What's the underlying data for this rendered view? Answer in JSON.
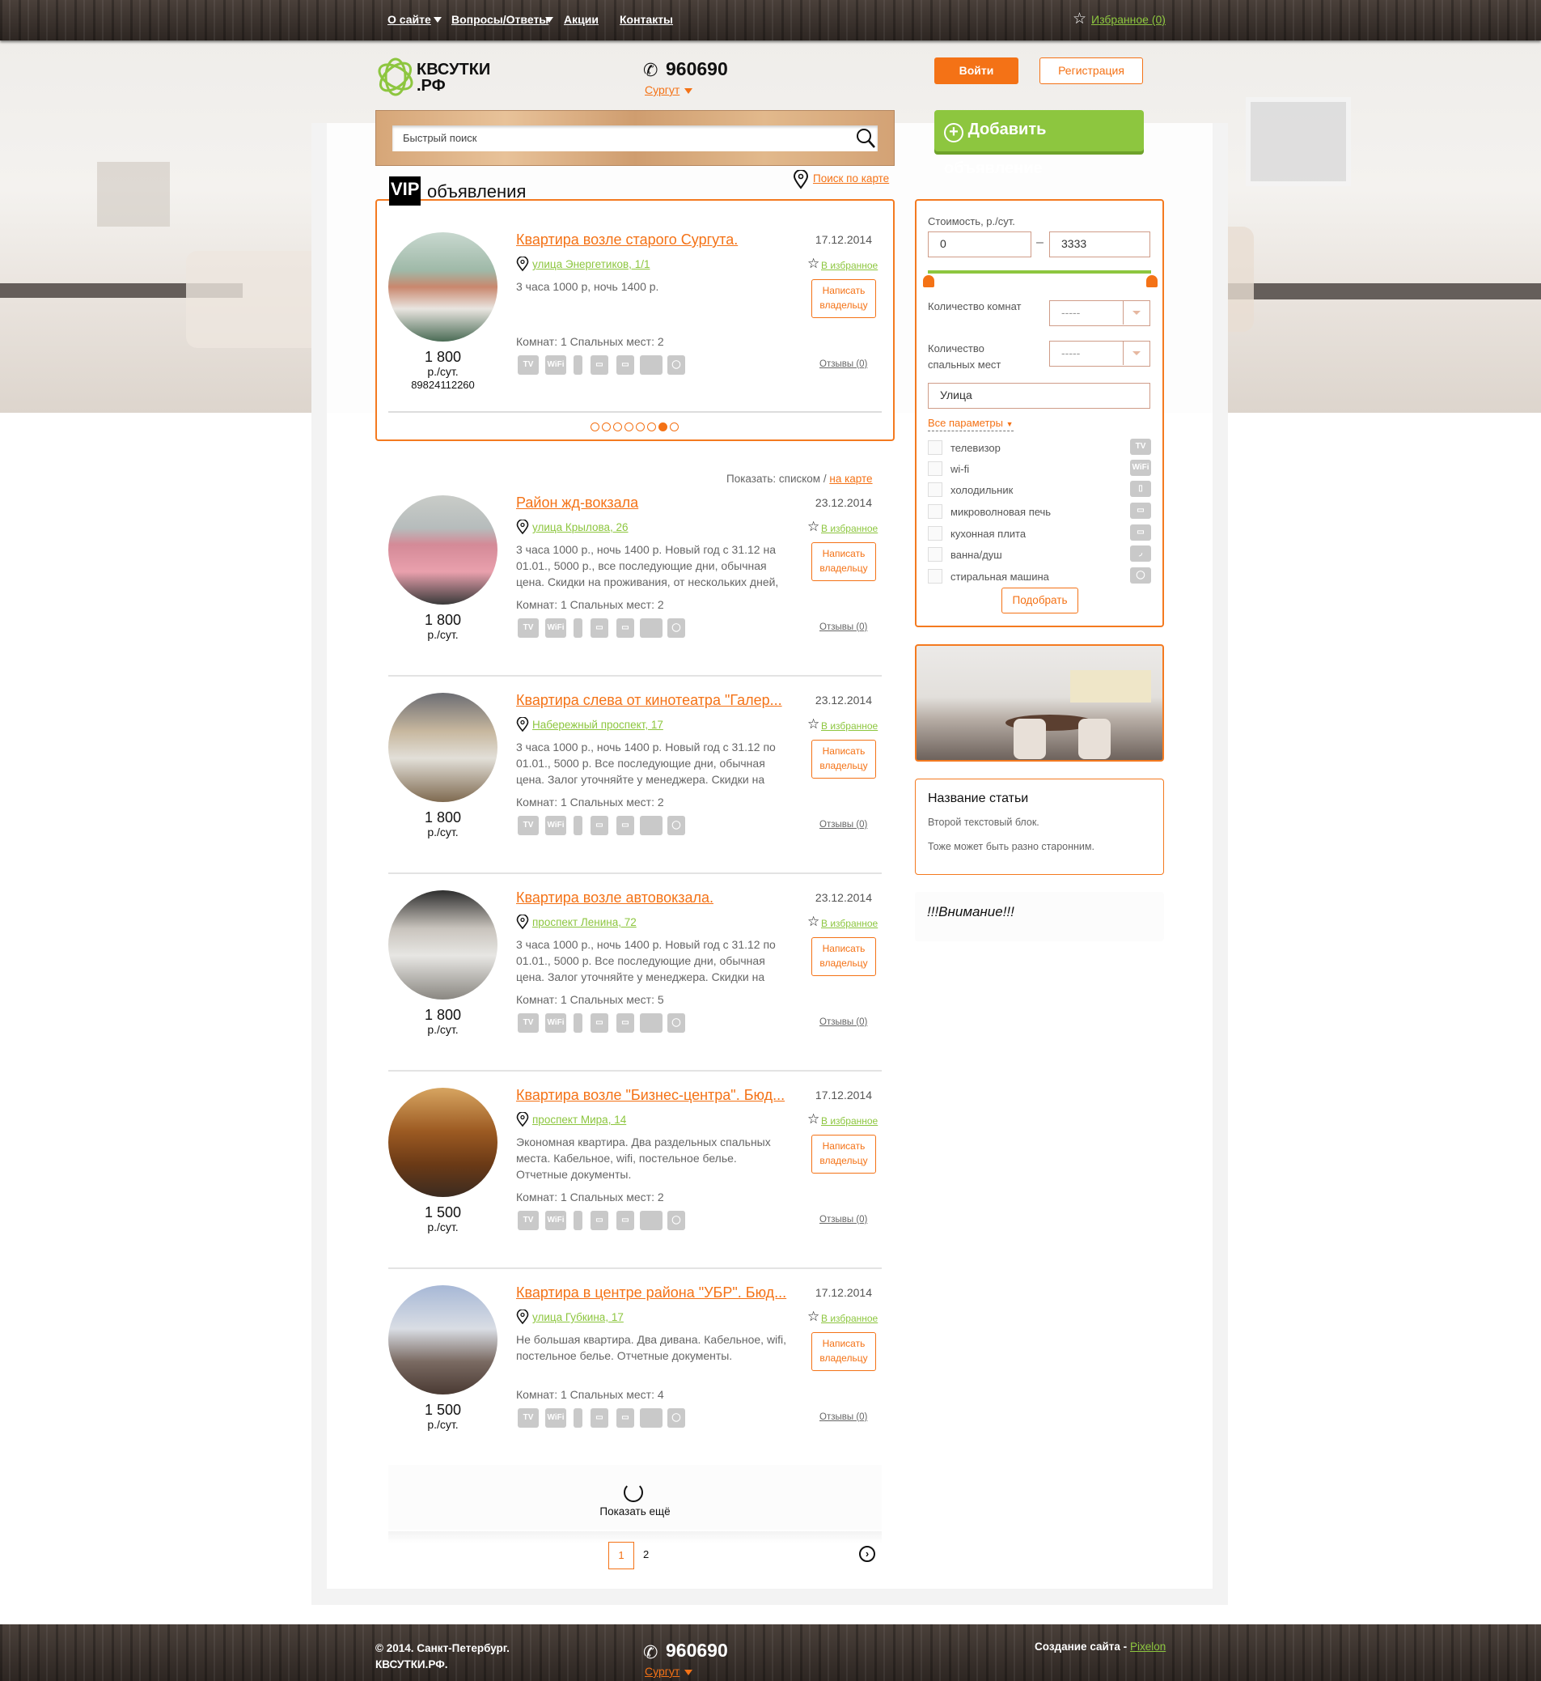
{
  "topnav": {
    "items": [
      {
        "label": "О сайте",
        "dropdown": true
      },
      {
        "label": "Вопросы/Ответы",
        "dropdown": true
      },
      {
        "label": "Акции"
      },
      {
        "label": "Контакты"
      }
    ],
    "favorites": "Избранное (0)"
  },
  "header": {
    "logo_line1": "КВСУТКИ",
    "logo_line2": ".РФ",
    "phone": "960690",
    "city": "Сургут",
    "login": "Войти",
    "register": "Регистрация",
    "add_listing": "Добавить объявление",
    "search_placeholder": "Быстрый поиск",
    "map_search": "Поиск по карте"
  },
  "vip": {
    "badge": "VIP",
    "heading": "объявления",
    "active_dot": 7,
    "dot_count": 8,
    "listing": {
      "title": "Квартира возле старого Сургута.",
      "address": "улица Энергетиков, 1/1",
      "date": "17.12.2014",
      "description": "3 часа 1000 р, ночь 1400 р.",
      "rooms": "Комнат: 1 Спальных мест: 2",
      "price": "1 800",
      "unit": "р./сут.",
      "phone": "89824112260",
      "photo": "kitchen-green"
    }
  },
  "view_toggle": {
    "label": "Показать: списком /",
    "map": "на карте"
  },
  "common": {
    "favorite": "В избранное",
    "write_line1": "Написать",
    "write_line2": "владельцу",
    "reviews": "Отзывы (0)",
    "amenities": [
      "TV",
      "WiFi",
      "fridge",
      "microwave",
      "stove",
      "bath",
      "washer"
    ]
  },
  "listings": [
    {
      "title": "Район жд-вокзала",
      "address": "улица Крылова, 26",
      "date": "23.12.2014",
      "description": "3 часа 1000 р., ночь 1400 р. Новый год с 31.12 на 01.01., 5000 р., все последующие дни, обычная цена. Скидки на проживания, от нескольких дней,",
      "rooms": "Комнат: 1 Спальных мест: 2",
      "price": "1 800",
      "unit": "р./сут."
    },
    {
      "title": "Квартира слева от кинотеатра \"Галер...",
      "address": "Набережный проспект, 17",
      "date": "23.12.2014",
      "description": "3 часа 1000 р., ночь 1400 р. Новый год с 31.12 по 01.01., 5000 р. Все последующие дни, обычная цена. Залог уточняйте у менеджера. Скидки на",
      "rooms": "Комнат: 1 Спальных мест: 2",
      "price": "1 800",
      "unit": "р./сут."
    },
    {
      "title": "Квартира возле автовокзала.",
      "address": "проспект Ленина, 72",
      "date": "23.12.2014",
      "description": "3 часа 1000 р., ночь 1400 р. Новый год с 31.12 по 01.01., 5000 р. Все последующие дни, обычная цена. Залог уточняйте у менеджера. Скидки на",
      "rooms": "Комнат: 1 Спальных мест: 5",
      "price": "1 800",
      "unit": "р./сут."
    },
    {
      "title": "Квартира возле \"Бизнес-центра\". Бюд...",
      "address": "проспект Мира, 14",
      "date": "17.12.2014",
      "description": "Экономная квартира. Два раздельных спальных места. Кабельное, wifi, постельное белье. Отчетные документы.",
      "rooms": "Комнат: 1 Спальных мест: 2",
      "price": "1 500",
      "unit": "р./сут."
    },
    {
      "title": "Квартира в центре района \"УБР\". Бюд...",
      "address": "улица Губкина, 17",
      "date": "17.12.2014",
      "description": "Не большая квартира. Два дивана. Кабельное, wifi, постельное белье. Отчетные документы.",
      "rooms": "Комнат: 1 Спальных мест: 4",
      "price": "1 500",
      "unit": "р./сут."
    }
  ],
  "show_more": "Показать ещё",
  "pagination": {
    "pages": [
      "1",
      "2"
    ],
    "current": "1"
  },
  "filter": {
    "price_label": "Стоимость, р./сут.",
    "price_min": "0",
    "price_max": "3333",
    "dash": "–",
    "rooms_label": "Количество комнат",
    "rooms_value": "-----",
    "beds_label_1": "Количество",
    "beds_label_2": "спальных мест",
    "beds_value": "-----",
    "street_placeholder": "Улица",
    "all_params": "Все параметры",
    "options": [
      "телевизор",
      "wi-fi",
      "холодильник",
      "микроволновая печь",
      "кухонная плита",
      "ванна/душ",
      "стиральная машина"
    ],
    "submit": "Подобрать"
  },
  "article": {
    "title": "Название статьи",
    "p1": "Второй текстовый блок.",
    "p2": "Тоже может быть разно старонним."
  },
  "attention": "!!!Внимание!!!",
  "footer": {
    "copyright_1": "© 2014. Санкт-Петербург.",
    "copyright_2": "КВСУТКИ.РФ.",
    "phone": "960690",
    "city": "Сургут",
    "credit": "Создание сайта -",
    "credit_link": "Pixelon"
  },
  "colors": {
    "accent": "#f47216",
    "green": "#8dc63f"
  }
}
